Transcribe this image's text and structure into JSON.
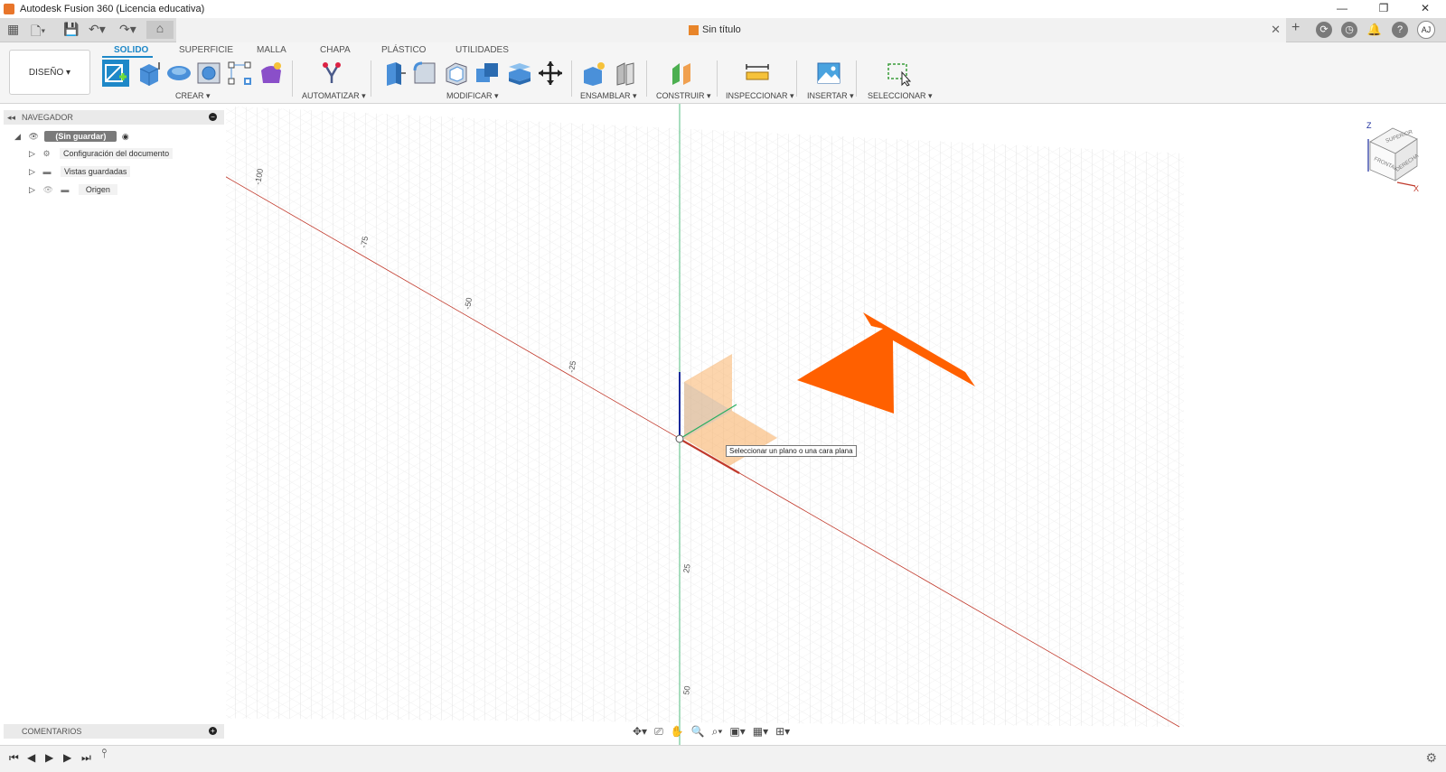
{
  "window": {
    "title": "Autodesk Fusion 360 (Licencia educativa)",
    "controls": [
      "—",
      "❐",
      "✕"
    ]
  },
  "document_tab": {
    "title": "Sin título",
    "close": "✕"
  },
  "user": {
    "initials": "AJ"
  },
  "ribbon": {
    "workspace": "DISEÑO ▾",
    "tabs": [
      "SOLIDO",
      "SUPERFICIE",
      "MALLA",
      "CHAPA",
      "PLÁSTICO",
      "UTILIDADES"
    ],
    "groups": [
      "CREAR ▾",
      "AUTOMATIZAR ▾",
      "MODIFICAR ▾",
      "ENSAMBLAR ▾",
      "CONSTRUIR ▾",
      "INSPECCIONAR ▾",
      "INSERTAR ▾",
      "SELECCIONAR ▾"
    ]
  },
  "navigator": {
    "title": "NAVEGADOR",
    "root": "(Sin guardar)",
    "items": [
      "Configuración del documento",
      "Vistas guardadas",
      "Origen"
    ]
  },
  "comments": {
    "title": "COMENTARIOS"
  },
  "viewport": {
    "tooltip": "Seleccionar un plano o una cara plana",
    "x_axis_ticks": [
      "-100",
      "-75",
      "-50",
      "-25"
    ],
    "y_axis_ticks": [
      "25",
      "50"
    ],
    "viewcube": {
      "top": "SUPERIOR",
      "front": "FRONTAL",
      "right": "DERECHA",
      "z": "Z",
      "x": "X"
    }
  },
  "colors": {
    "accent": "#1e88c8",
    "arrow": "#ff6000",
    "plane": "#f9b36a",
    "x_axis": "#c0392b",
    "y_axis": "#27ae60",
    "z_axis": "#1a2b9c"
  }
}
